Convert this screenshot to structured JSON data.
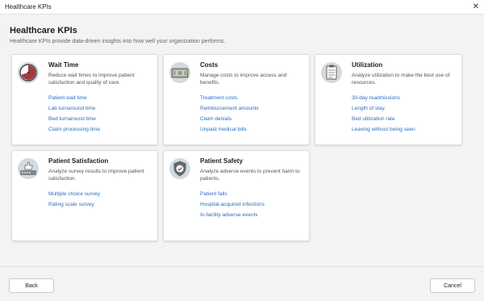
{
  "window": {
    "title": "Healthcare KPIs"
  },
  "header": {
    "title": "Healthcare KPIs",
    "subtitle": "Healthcare KPIs provide data-driven insights into how well your organization performs."
  },
  "cards": [
    {
      "title": "Wait Time",
      "description": "Reduce wait times to improve patient satisfaction and quality of care.",
      "icon": "clock-icon",
      "links": [
        "Patient wait time",
        "Lab turnaround time",
        "Bed turnaround time",
        "Claim processing time"
      ]
    },
    {
      "title": "Costs",
      "description": "Manage costs to improve access and benefits.",
      "icon": "money-icon",
      "links": [
        "Treatment costs",
        "Reimbursement amounts",
        "Claim denials",
        "Unpaid medical bills"
      ]
    },
    {
      "title": "Utilization",
      "description": "Analyze utilization to make the best use of resources.",
      "icon": "clipboard-icon",
      "links": [
        "30-day readmissions",
        "Length of stay",
        "Bed utilization rate",
        "Leaving without being seen"
      ]
    },
    {
      "title": "Patient Satisfaction",
      "description": "Analyze survey results to improve patient satisfaction.",
      "icon": "thumbs-up-icon",
      "links": [
        "Multiple choice survey",
        "Rating scale survey"
      ]
    },
    {
      "title": "Patient Safety",
      "description": "Analyze adverse events to prevent harm to patients.",
      "icon": "shield-check-icon",
      "links": [
        "Patient falls",
        "Hospital-acquired infections",
        "In-facility adverse events"
      ]
    }
  ],
  "footer": {
    "back_label": "Back",
    "cancel_label": "Cancel"
  },
  "colors": {
    "link": "#2a6fc4",
    "accent_red": "#a33a3a",
    "icon_bg": "#d4d9de"
  }
}
